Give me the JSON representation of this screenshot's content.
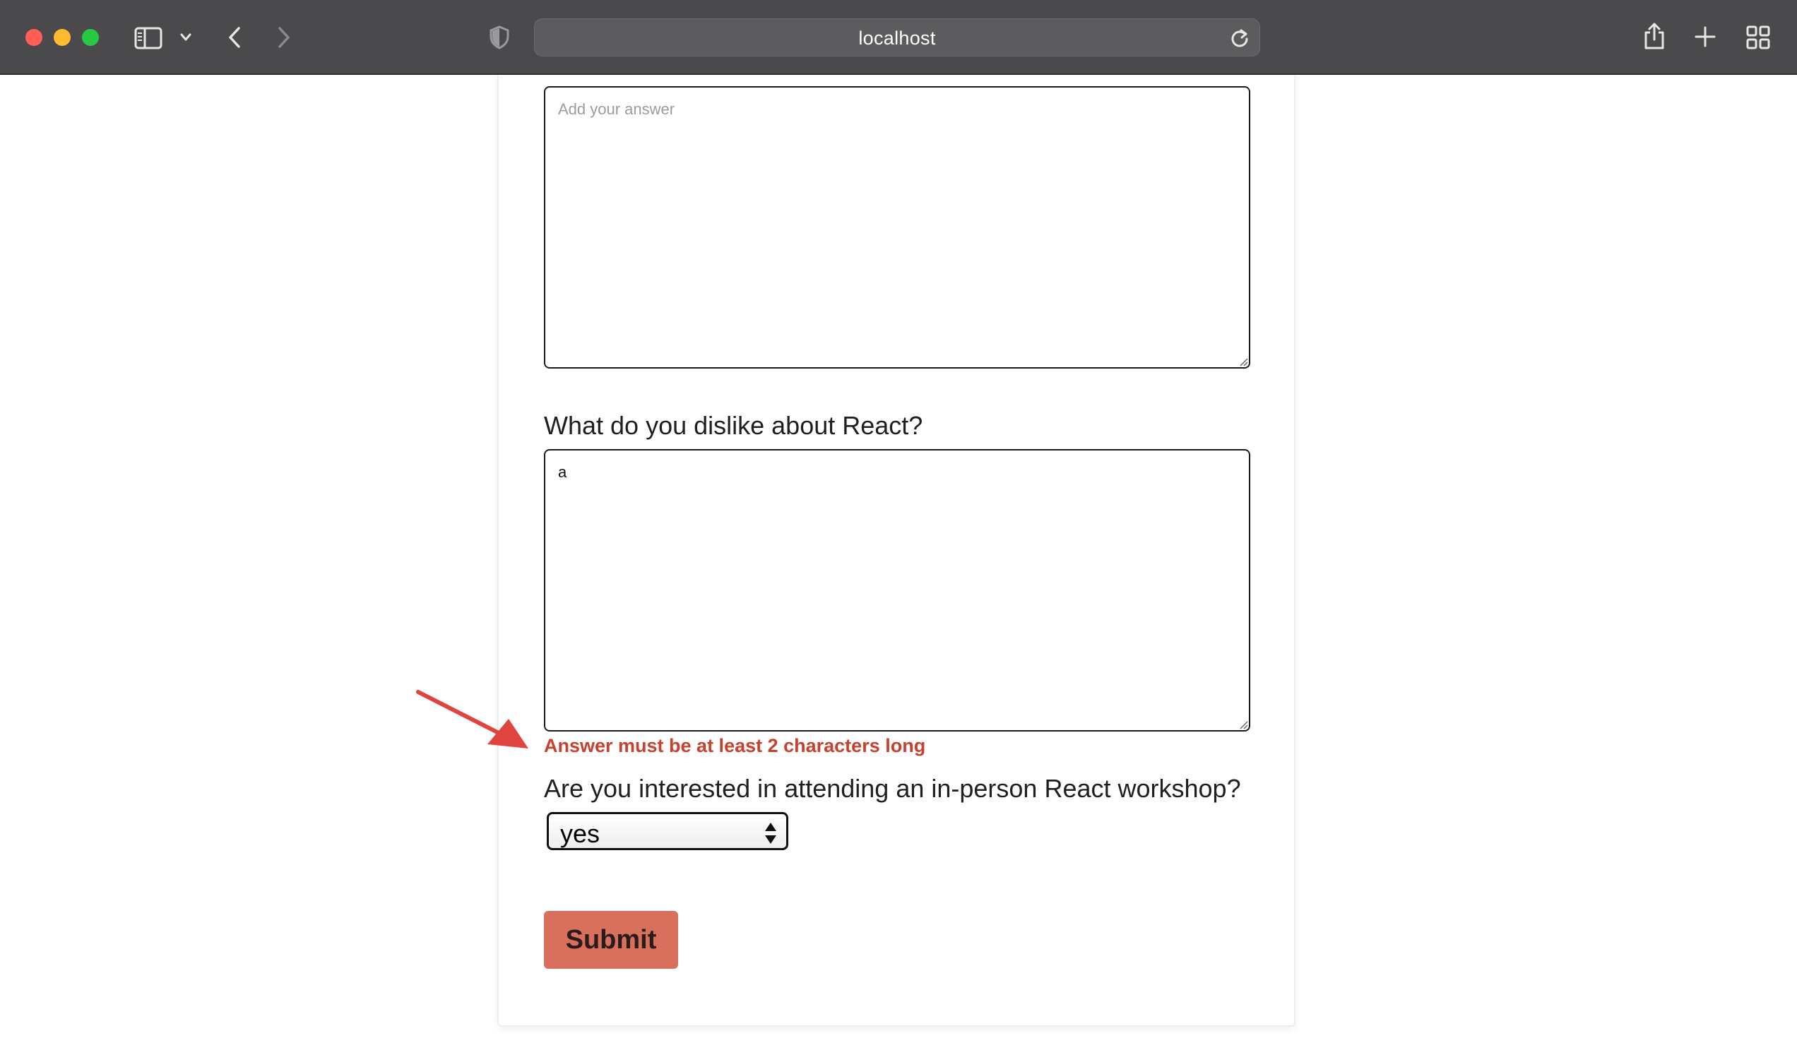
{
  "browser": {
    "url": "localhost",
    "icons": [
      "sidebar-icon",
      "chevron-down-icon",
      "back-icon",
      "forward-icon",
      "shield-icon",
      "reload-icon",
      "share-icon",
      "new-tab-icon",
      "tab-overview-icon"
    ]
  },
  "form": {
    "q1": {
      "placeholder": "Add your answer"
    },
    "q2": {
      "label": "What do you dislike about React?",
      "value": "a",
      "error": "Answer must be at least 2 characters long"
    },
    "q3": {
      "label": "Are you interested in attending an in-person React workshop?",
      "selected": "yes"
    },
    "submit_label": "Submit"
  },
  "colors": {
    "error": "#c8412f",
    "submit_bg": "#d9705e",
    "arrow": "#e0443e"
  }
}
